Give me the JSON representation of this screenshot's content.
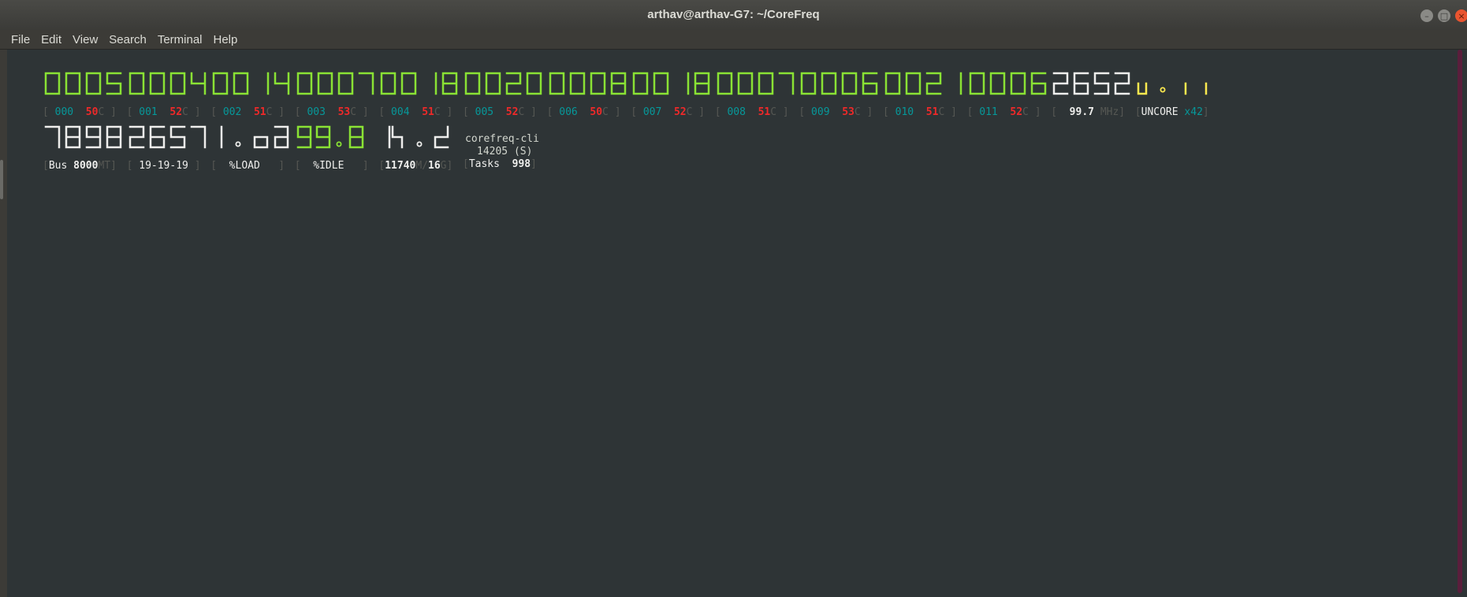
{
  "window": {
    "title": "arthav@arthav-G7: ~/CoreFreq",
    "buttons": {
      "minimize": "–",
      "maximize": "□",
      "close": "×"
    }
  },
  "menu": [
    "File",
    "Edit",
    "View",
    "Search",
    "Terminal",
    "Help"
  ],
  "colors": {
    "green": "#8ae234",
    "white": "#eeeeec",
    "yellow": "#fce94f",
    "cyan": "#06989a",
    "red": "#ef2929",
    "grey": "#555753"
  },
  "cores": [
    {
      "digits": "0005",
      "id": "000",
      "temp": "50"
    },
    {
      "digits": "0004",
      "id": "001",
      "temp": "52"
    },
    {
      "digits": "0014",
      "id": "002",
      "temp": "51"
    },
    {
      "digits": "0007",
      "id": "003",
      "temp": "53"
    },
    {
      "digits": "0018",
      "id": "004",
      "temp": "51"
    },
    {
      "digits": "0020",
      "id": "005",
      "temp": "52"
    },
    {
      "digits": "0008",
      "id": "006",
      "temp": "50"
    },
    {
      "digits": "0018",
      "id": "007",
      "temp": "52"
    },
    {
      "digits": "0007",
      "id": "008",
      "temp": "51"
    },
    {
      "digits": "0006",
      "id": "009",
      "temp": "53"
    },
    {
      "digits": "0021",
      "id": "010",
      "temp": "51"
    },
    {
      "digits": "0006",
      "id": "011",
      "temp": "52"
    }
  ],
  "temp_unit": "C",
  "freq": {
    "digits": "2652",
    "value": "99.7",
    "unit": "MHz"
  },
  "uncore": {
    "label": "UNCORE",
    "ratio": "x42"
  },
  "bus": {
    "digits": "7898",
    "label": "Bus",
    "value": "8000",
    "unit": "MT"
  },
  "timing": {
    "digits": "2657",
    "value": "19-19-19"
  },
  "load": {
    "label": "%LOAD"
  },
  "idle": {
    "label": "%IDLE"
  },
  "memory": {
    "used": "11740",
    "used_unit": "M",
    "total": "16",
    "total_unit": "G"
  },
  "process": {
    "name": "corefreq-cli",
    "pid": "14205",
    "state": "(S)"
  },
  "tasks": {
    "label": "Tasks",
    "count": "998"
  }
}
